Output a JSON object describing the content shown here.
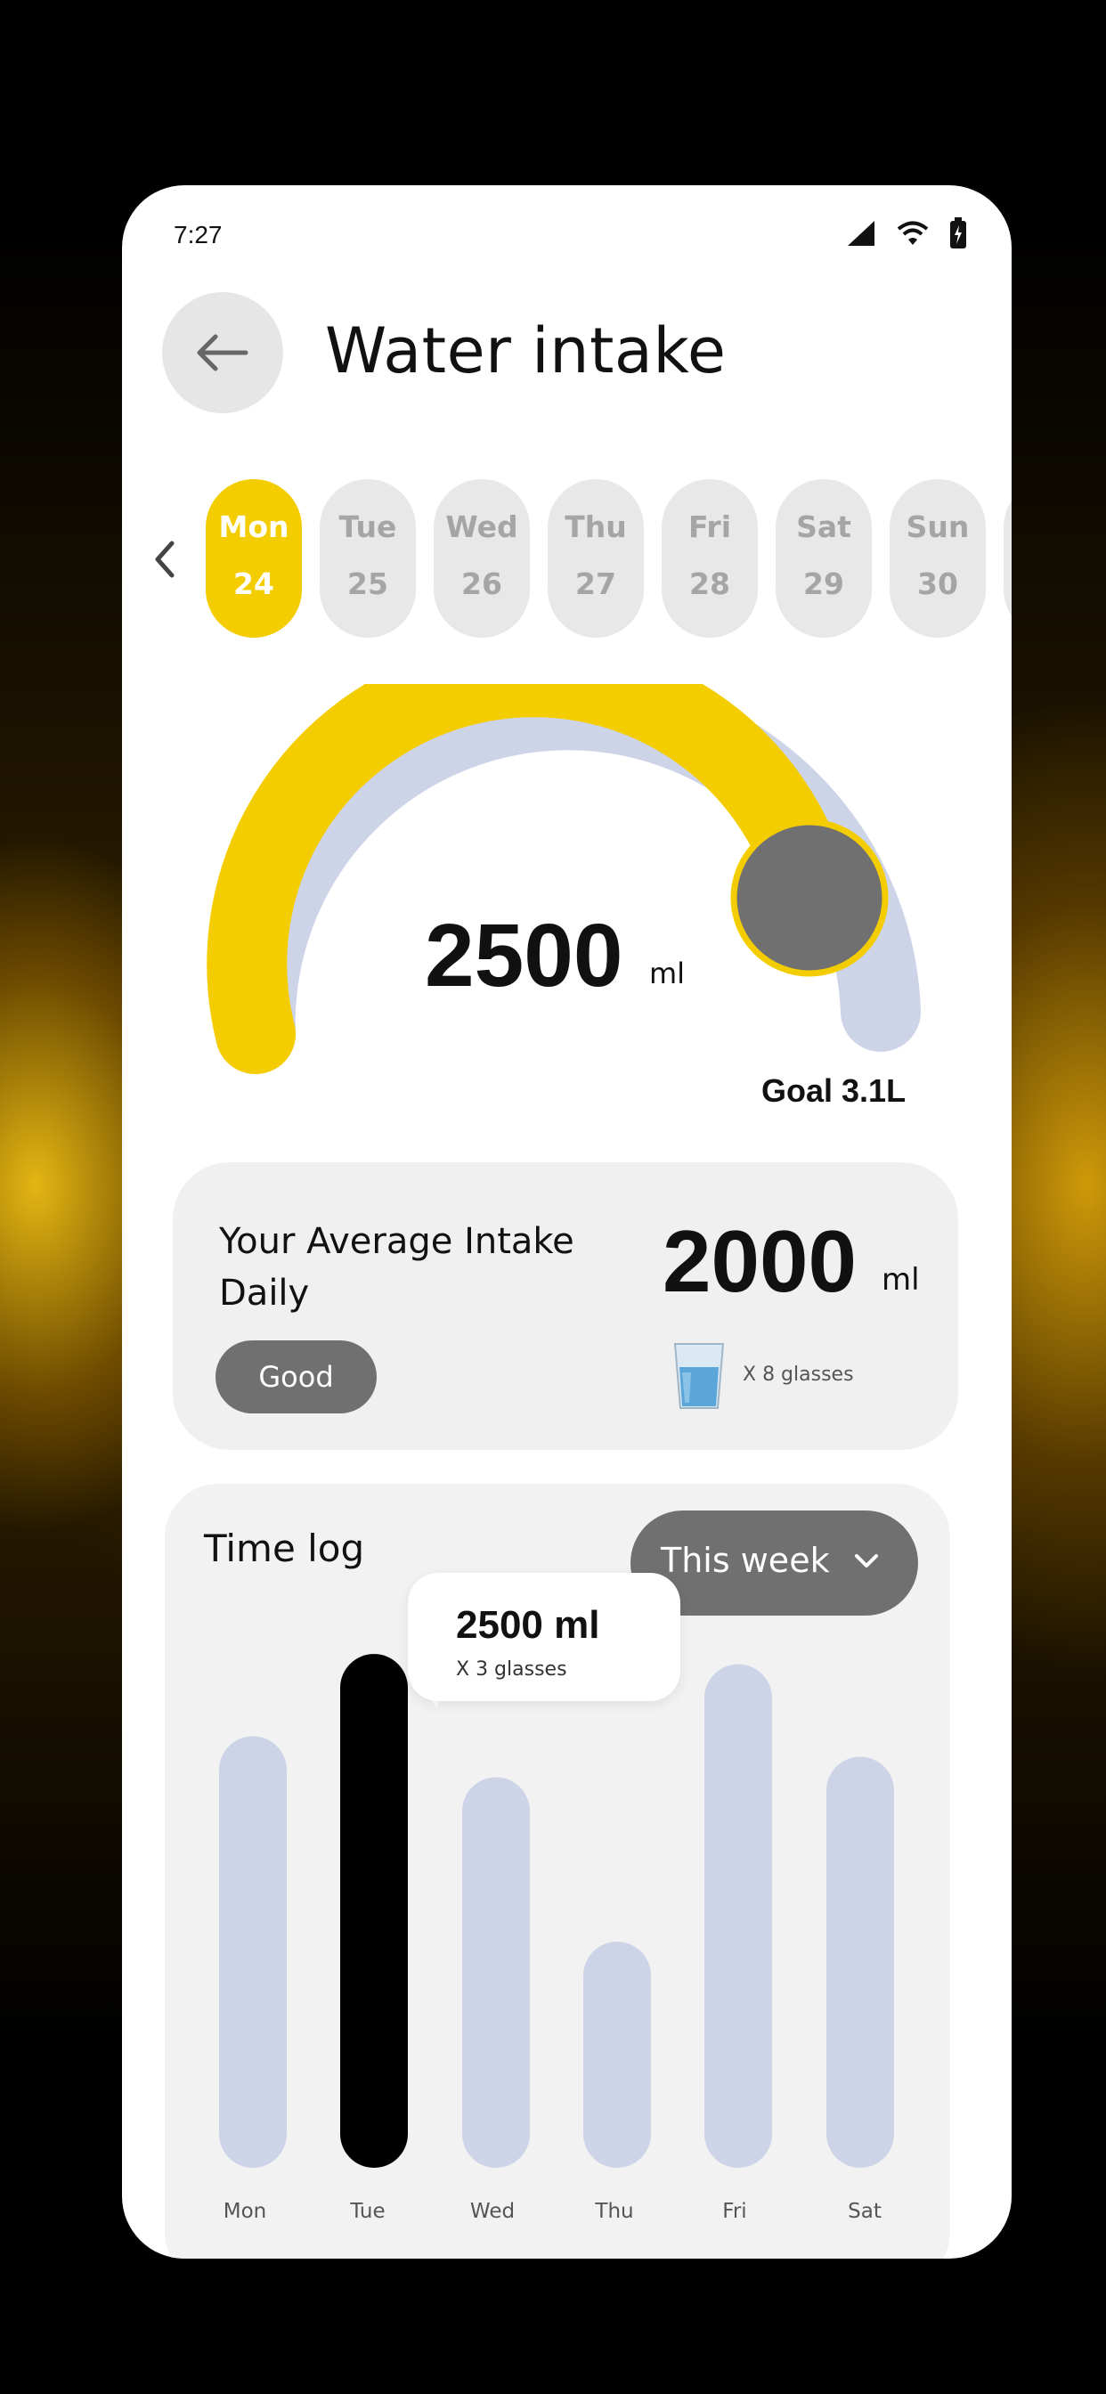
{
  "status_bar": {
    "time": "7:27"
  },
  "header": {
    "title": "Water intake"
  },
  "days": [
    {
      "name": "Mon",
      "date": "24",
      "active": true
    },
    {
      "name": "Tue",
      "date": "25",
      "active": false
    },
    {
      "name": "Wed",
      "date": "26",
      "active": false
    },
    {
      "name": "Thu",
      "date": "27",
      "active": false
    },
    {
      "name": "Fri",
      "date": "28",
      "active": false
    },
    {
      "name": "Sat",
      "date": "29",
      "active": false
    },
    {
      "name": "Sun",
      "date": "30",
      "active": false
    }
  ],
  "gauge": {
    "value": "2500",
    "unit": "ml",
    "goal_label": "Goal 3.1L",
    "progress": 0.8
  },
  "average": {
    "title": "Your Average Intake Daily",
    "rating": "Good",
    "value": "2000",
    "unit": "ml",
    "glasses": "X 8 glasses"
  },
  "time_log": {
    "title": "Time log",
    "range": "This week",
    "tooltip": {
      "value": "2500 ml",
      "glasses": "X 3 glasses"
    }
  },
  "colors": {
    "accent": "#f4cd00",
    "bar": "#cdd4e8",
    "highlight_bar": "#000000",
    "pill": "#707070"
  },
  "icons": [
    "back-arrow-icon",
    "chevron-left-icon",
    "chevron-down-icon",
    "signal-icon",
    "wifi-icon",
    "battery-icon",
    "water-glass-icon"
  ],
  "chart_data": {
    "type": "bar",
    "categories": [
      "Mon",
      "Tue",
      "Wed",
      "Thu",
      "Fri",
      "Sat"
    ],
    "values": [
      2100,
      2500,
      1900,
      1100,
      2450,
      2000
    ],
    "highlight": "Tue"
  }
}
